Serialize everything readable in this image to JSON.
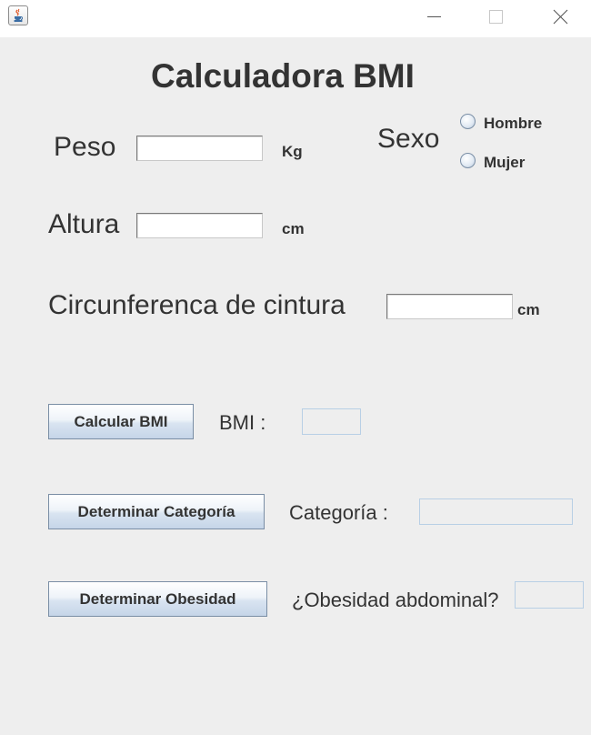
{
  "window": {
    "minimize_icon": "minimize-icon",
    "maximize_icon": "maximize-icon",
    "close_icon": "close-icon",
    "app_icon": "java-coffee-cup-icon"
  },
  "form": {
    "title": "Calculadora BMI",
    "peso": {
      "label": "Peso",
      "value": "",
      "unit": "Kg"
    },
    "altura": {
      "label": "Altura",
      "value": "",
      "unit": "cm"
    },
    "cintura": {
      "label": "Circunferenca de cintura",
      "value": "",
      "unit": "cm"
    },
    "sexo": {
      "label": "Sexo",
      "options": [
        {
          "label": "Hombre",
          "selected": false
        },
        {
          "label": "Mujer",
          "selected": false
        }
      ]
    }
  },
  "actions": {
    "bmi": {
      "button": "Calcular BMI",
      "label": "BMI :",
      "result": ""
    },
    "categoria": {
      "button": "Determinar Categoría",
      "label": "Categoría :",
      "result": ""
    },
    "obesidad": {
      "button": "Determinar Obesidad",
      "label": "¿Obesidad abdominal?",
      "result": ""
    }
  },
  "colors": {
    "background": "#eeeeee",
    "titlebar": "#ffffff",
    "text": "#333333",
    "button_border": "#7a8ea5",
    "result_border": "#b8cfe5"
  }
}
